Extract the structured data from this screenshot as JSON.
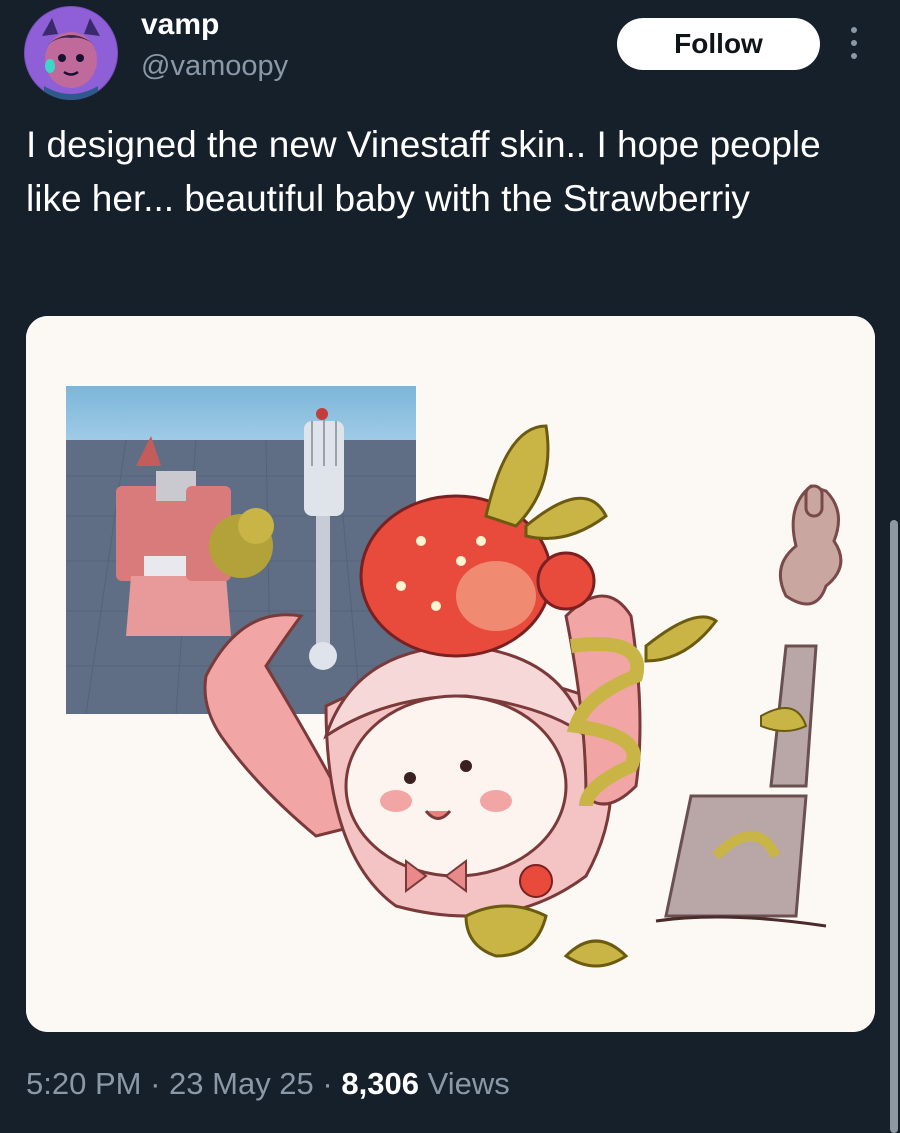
{
  "author": {
    "display_name": "vamp",
    "handle": "@vamoopy"
  },
  "follow_button": {
    "label": "Follow"
  },
  "more_menu": {
    "icon": "more-vertical-icon"
  },
  "tweet": {
    "text": "I designed the new Vinestaff skin.. I hope people like her... beautiful baby with the Strawberriy"
  },
  "media": {
    "icon": "image-artwork"
  },
  "meta": {
    "time": "5:20 PM",
    "sep1": "·",
    "date": "23 May 25",
    "sep2": "·",
    "views_count": "8,306",
    "views_label": "Views"
  },
  "colors": {
    "background": "#15202b",
    "secondary_text": "#8b98a5",
    "follow_bg": "#ffffff",
    "follow_text": "#0f1419"
  }
}
